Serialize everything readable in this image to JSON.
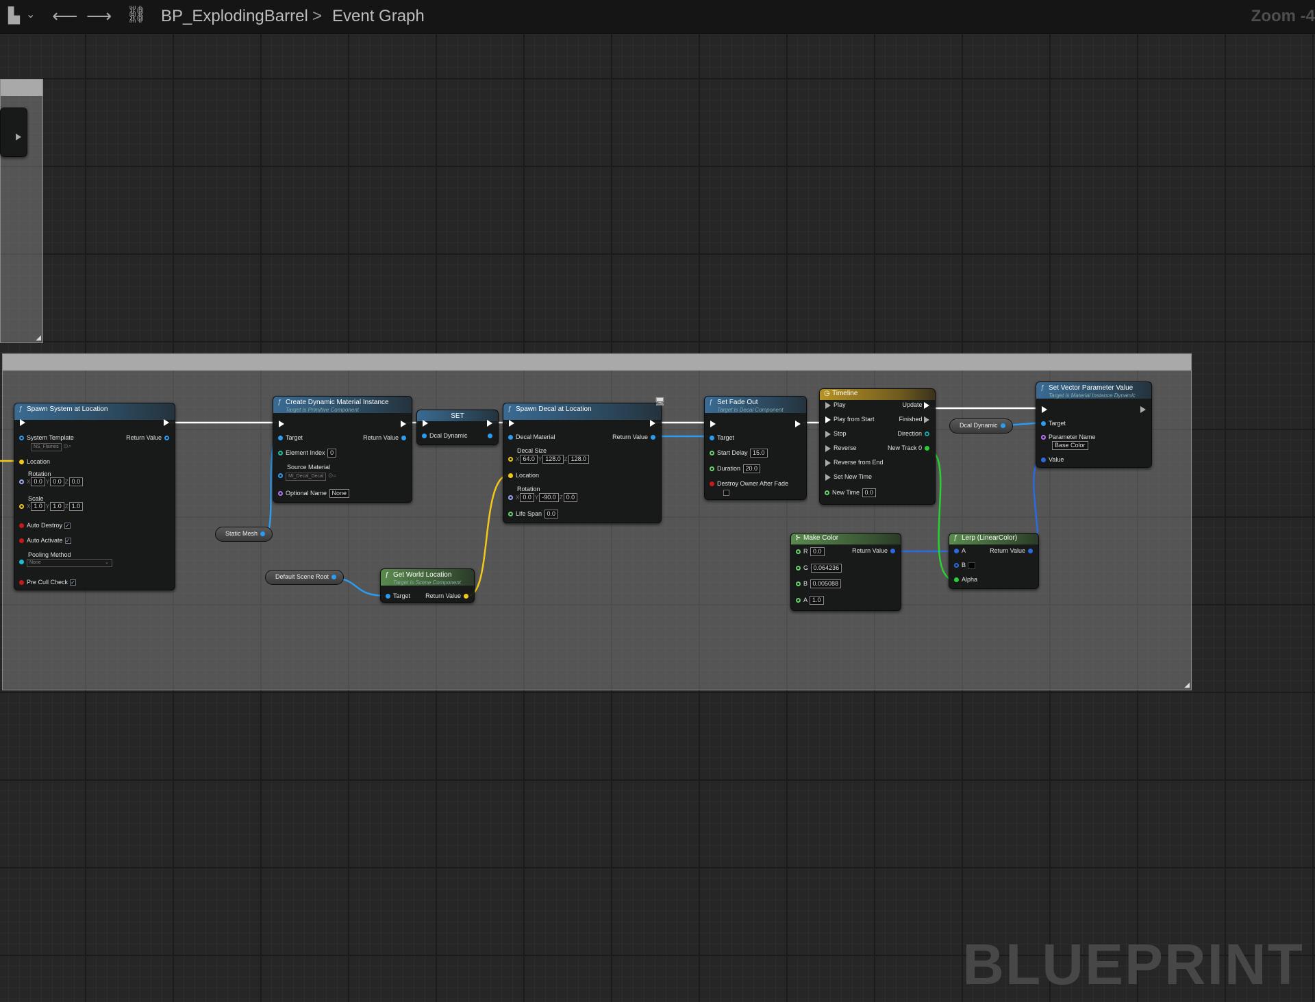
{
  "topbar": {
    "bookmark_icon": "bookmark-icon",
    "back_icon": "arrow-left-icon",
    "forward_icon": "arrow-right-icon",
    "graph_icon": "blueprint-graph-icon",
    "breadcrumb_root": "BP_ExplodingBarrel",
    "breadcrumb_separator": ">",
    "breadcrumb_leaf": "Event Graph",
    "zoom": "Zoom -4"
  },
  "watermark": "BLUEPRINT",
  "nodes": {
    "spawn_system": {
      "title": "Spawn System at Location",
      "system_template": "System Template",
      "system_template_value": "NS_Flames",
      "return_value": "Return Value",
      "location": "Location",
      "rotation": "Rotation",
      "rot_x": "0.0",
      "rot_y": "0.0",
      "rot_z": "0.0",
      "scale": "Scale",
      "scale_x": "1.0",
      "scale_y": "1.0",
      "scale_z": "1.0",
      "auto_destroy": "Auto Destroy",
      "auto_activate": "Auto Activate",
      "pooling_method": "Pooling Method",
      "pooling_value": "None",
      "pre_cull": "Pre Cull Check"
    },
    "create_dmi": {
      "title": "Create Dynamic Material Instance",
      "subtitle": "Target is Primitive Component",
      "target": "Target",
      "return_value": "Return Value",
      "element_index": "Element Index",
      "element_index_value": "0",
      "source_material": "Source Material",
      "source_material_value": "MI_Decal_Decal",
      "optional_name": "Optional Name",
      "optional_name_value": "None"
    },
    "set_var": {
      "title": "SET",
      "pin": "Dcal Dynamic"
    },
    "spawn_decal": {
      "title": "Spawn Decal at Location",
      "decal_material": "Decal Material",
      "return_value": "Return Value",
      "decal_size": "Decal Size",
      "size_x": "64.0",
      "size_y": "128.0",
      "size_z": "128.0",
      "location": "Location",
      "rotation": "Rotation",
      "rot_x": "0.0",
      "rot_y": "-90.0",
      "rot_z": "0.0",
      "life_span": "Life Span",
      "life_span_value": "0.0"
    },
    "set_fade_out": {
      "title": "Set Fade Out",
      "subtitle": "Target is Decal Component",
      "target": "Target",
      "start_delay": "Start Delay",
      "start_delay_value": "15.0",
      "duration": "Duration",
      "duration_value": "20.0",
      "destroy_owner": "Destroy Owner After Fade"
    },
    "timeline": {
      "title": "Timeline",
      "play": "Play",
      "play_from_start": "Play from Start",
      "stop": "Stop",
      "reverse": "Reverse",
      "reverse_from_end": "Reverse from End",
      "set_new_time": "Set New Time",
      "new_time": "New Time",
      "new_time_value": "0.0",
      "update": "Update",
      "finished": "Finished",
      "direction": "Direction",
      "new_track": "New Track 0"
    },
    "set_vector": {
      "title": "Set Vector Parameter Value",
      "subtitle": "Target is Material Instance Dynamic",
      "target": "Target",
      "parameter_name": "Parameter Name",
      "parameter_name_value": "Base Color",
      "value": "Value"
    },
    "make_color": {
      "title": "Make Color",
      "r": "R",
      "r_value": "0.0",
      "g": "G",
      "g_value": "0.064236",
      "b": "B",
      "b_value": "0.005088",
      "a": "A",
      "a_value": "1.0",
      "return_value": "Return Value"
    },
    "lerp": {
      "title": "Lerp (LinearColor)",
      "a": "A",
      "b": "B",
      "alpha": "Alpha",
      "return_value": "Return Value"
    },
    "get_world_location": {
      "title": "Get World Location",
      "subtitle": "Target is Scene Component",
      "target": "Target",
      "return_value": "Return Value"
    }
  },
  "variables": {
    "static_mesh": "Static Mesh",
    "default_scene_root": "Default Scene Root",
    "dcal_dynamic": "Dcal Dynamic"
  },
  "colors": {
    "object_pin": "#2c9cf0",
    "vector_pin": "#f2c81a",
    "float_pin": "#6bd06b",
    "bool_pin": "#c81a1a",
    "name_pin": "#b476f5"
  }
}
